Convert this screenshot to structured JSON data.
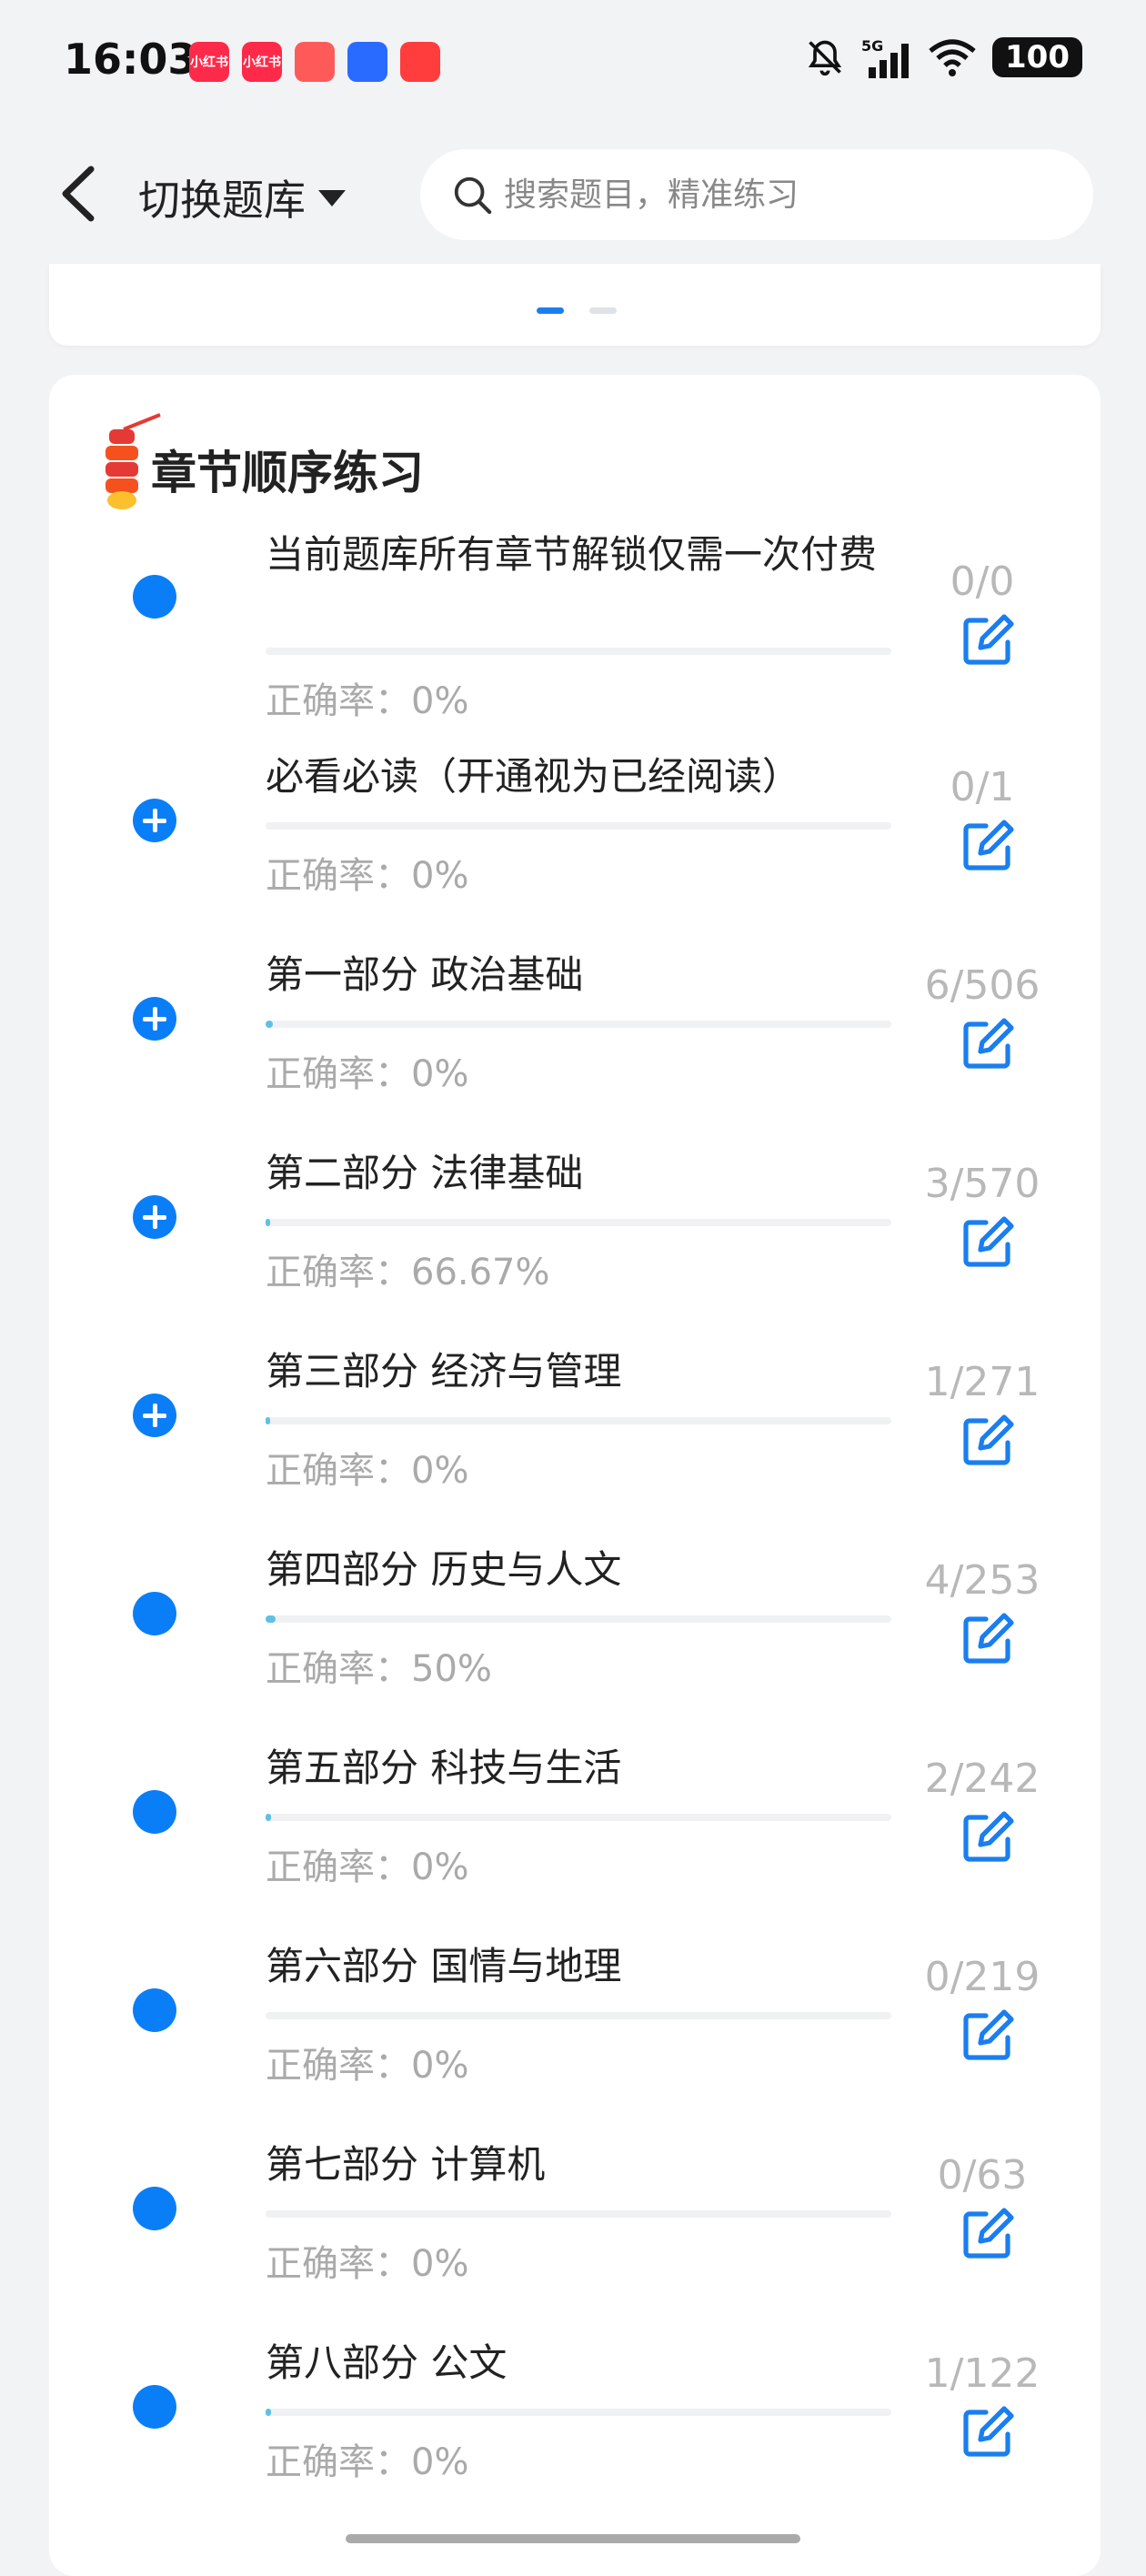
{
  "status_bar": {
    "time": "16:03",
    "apps": [
      {
        "label": "小红书",
        "color": "#ff2a4a"
      },
      {
        "label": "小红书",
        "color": "#ff2a4a"
      },
      {
        "label": "",
        "color": "#ff5a5a"
      },
      {
        "label": "",
        "color": "#2a6bff"
      },
      {
        "label": "",
        "color": "#ff3d3d"
      }
    ],
    "network": "5G",
    "battery": "100"
  },
  "header": {
    "switch_label": "切换题库",
    "search_placeholder": "搜索题目，精准练习"
  },
  "card": {
    "title": "章节顺序练习",
    "chapters": [
      {
        "title": "当前题库所有章节解锁仅需一次付费",
        "accuracy": "正确率：0%",
        "count": "0/0",
        "expandable": false,
        "progress": 0
      },
      {
        "title": "必看必读（开通视为已经阅读）",
        "accuracy": "正确率：0%",
        "count": "0/1",
        "expandable": true,
        "progress": 0
      },
      {
        "title": "第一部分 政治基础",
        "accuracy": "正确率：0%",
        "count": "6/506",
        "expandable": true,
        "progress": 0.012
      },
      {
        "title": "第二部分 法律基础",
        "accuracy": "正确率：66.67%",
        "count": "3/570",
        "expandable": true,
        "progress": 0.005
      },
      {
        "title": "第三部分 经济与管理",
        "accuracy": "正确率：0%",
        "count": "1/271",
        "expandable": true,
        "progress": 0.004
      },
      {
        "title": "第四部分 历史与人文",
        "accuracy": "正确率：50%",
        "count": "4/253",
        "expandable": false,
        "progress": 0.016
      },
      {
        "title": "第五部分 科技与生活",
        "accuracy": "正确率：0%",
        "count": "2/242",
        "expandable": false,
        "progress": 0.008
      },
      {
        "title": "第六部分 国情与地理",
        "accuracy": "正确率：0%",
        "count": "0/219",
        "expandable": false,
        "progress": 0
      },
      {
        "title": "第七部分 计算机",
        "accuracy": "正确率：0%",
        "count": "0/63",
        "expandable": false,
        "progress": 0
      },
      {
        "title": "第八部分 公文",
        "accuracy": "正确率：0%",
        "count": "1/122",
        "expandable": false,
        "progress": 0.008
      }
    ]
  }
}
